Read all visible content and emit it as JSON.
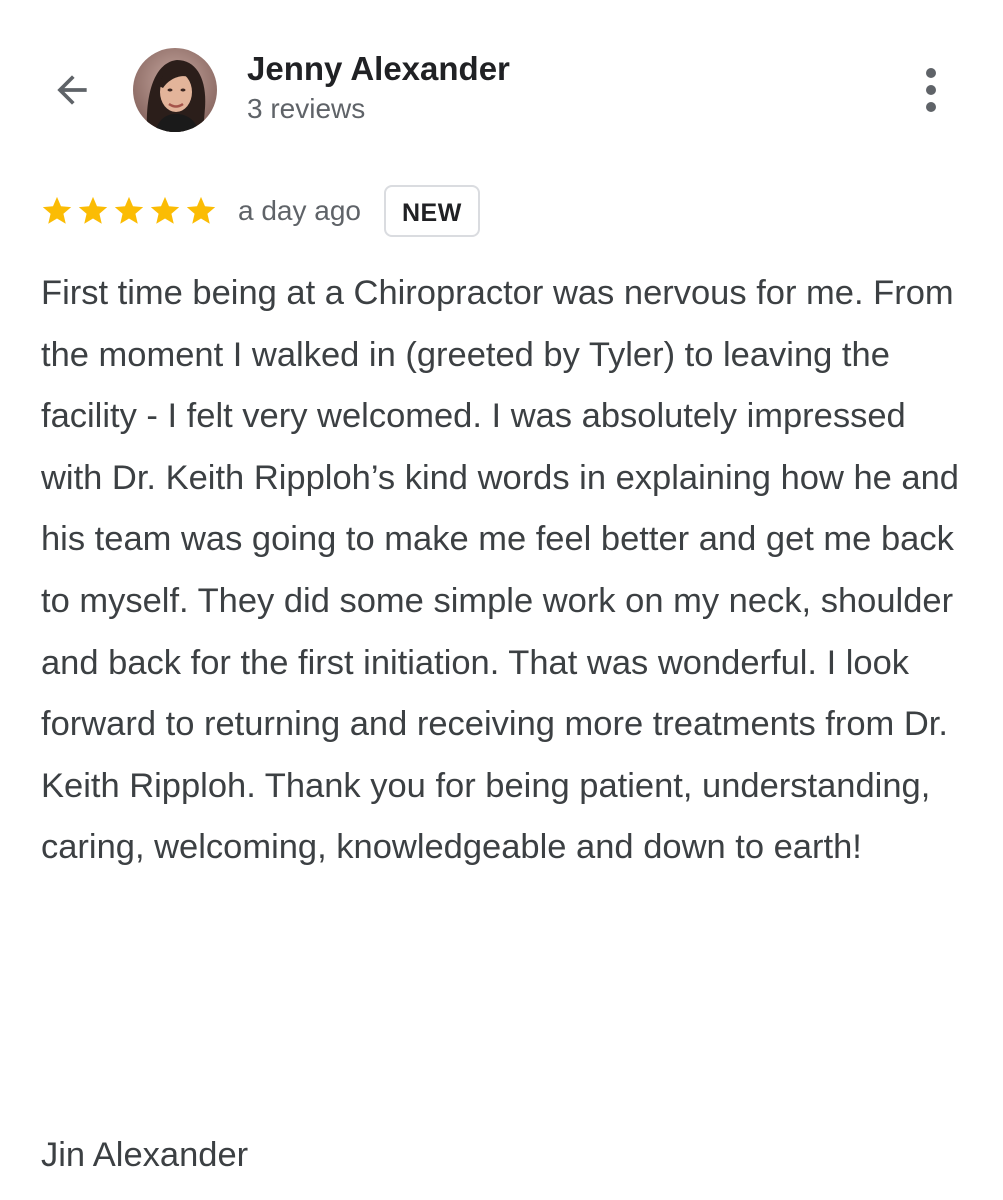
{
  "header": {
    "back_icon": "arrow-back-icon",
    "avatar_icon": "profile-photo",
    "reviewer_name": "Jenny Alexander",
    "review_count": "3 reviews",
    "more_icon": "more-vertical-icon"
  },
  "review": {
    "rating": 5,
    "rating_max": 5,
    "star_icon": "star-icon",
    "star_color": "#fbbc04",
    "time_ago": "a day ago",
    "badge": "NEW",
    "text": "First time being at a Chiropractor was nervous for me. From the moment I walked in (greeted by Tyler) to leaving the facility - I felt very welcomed. I was absolutely impressed with Dr. Keith Ripploh’s kind words in explaining how he and his team was going to make me feel better and get me back to myself. They did some simple work on my neck, shoulder and back for the first initiation. That was wonderful. I look forward to returning and receiving more treatments from Dr. Keith Ripploh. Thank you for being patient, understanding, caring, welcoming, knowledgeable and down to earth!",
    "signature": "Jin Alexander"
  },
  "colors": {
    "text_primary": "#202124",
    "text_body": "#3c4043",
    "text_secondary": "#5f6368",
    "badge_border": "#dadce0",
    "background": "#ffffff"
  }
}
